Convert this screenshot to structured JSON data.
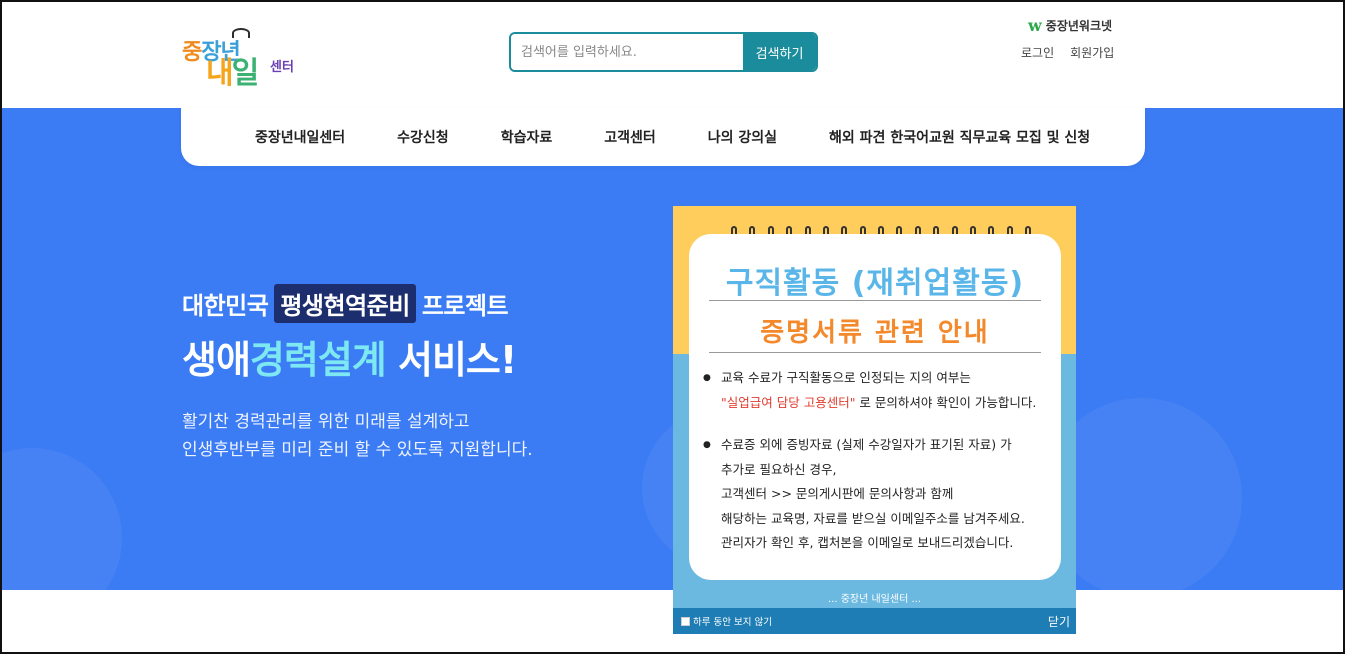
{
  "logo": {
    "line1_a": "중",
    "line1_b": "장년",
    "line2_a": "내",
    "line2_b": "일",
    "line3": "센터"
  },
  "search": {
    "placeholder": "검색어를 입력하세요.",
    "button_label": "검색하기"
  },
  "worknet": {
    "icon_char": "w",
    "label": "중장년워크넷"
  },
  "top_links": {
    "login": "로그인",
    "signup": "회원가입"
  },
  "nav": {
    "items": [
      {
        "label": "중장년내일센터"
      },
      {
        "label": "수강신청"
      },
      {
        "label": "학습자료"
      },
      {
        "label": "고객센터"
      },
      {
        "label": "나의 강의실"
      },
      {
        "label": "해외 파견 한국어교원 직무교육 모집 및 신청"
      }
    ]
  },
  "hero": {
    "line1_pre": "대한민국",
    "line1_highlight": "평생현역준비",
    "line1_post": "프로젝트",
    "line2_pre": "생애",
    "line2_accent": "경력설계",
    "line2_post": "서비스!",
    "sub1": "활기찬 경력관리를 위한 미래를 설계하고",
    "sub2": "인생후반부를 미리 준비 할 수 있도록 지원합니다."
  },
  "popup": {
    "title1": "구직활동 (재취업활동)",
    "title2": "증명서류 관련 안내",
    "b1_l1": "교육 수료가 구직활동으로 인정되는 지의 여부는",
    "b1_l2_red": "\"실업급여 담당 고용센터\"",
    "b1_l2_rest": " 로 문의하셔야 확인이 가능합니다.",
    "b2_l1": "수료증 외에 증빙자료 (실제 수강일자가 표기된 자료) 가",
    "b2_l2": "추가로 필요하신 경우,",
    "b2_l3": "고객센터 >> 문의게시판에 문의사항과 함께",
    "b2_l4": "해당하는 교육명, 자료를 받으실 이메일주소를 남겨주세요.",
    "b2_l5": "관리자가 확인 후, 캡처본을 이메일로 보내드리겠습니다.",
    "footer_text": "... 중장년 내일센터 ...",
    "dont_show_label": "하루 동안 보지 않기",
    "close_label": "닫기"
  },
  "colors": {
    "hero_blue": "#3b7bf4",
    "search_teal": "#1b8c9c",
    "popup_yellow": "#fecd5c",
    "popup_blue": "#6bb8e0",
    "popup_bar": "#1f7db5",
    "accent_cyan": "#7ee8f2",
    "title_orange": "#f4892c"
  }
}
